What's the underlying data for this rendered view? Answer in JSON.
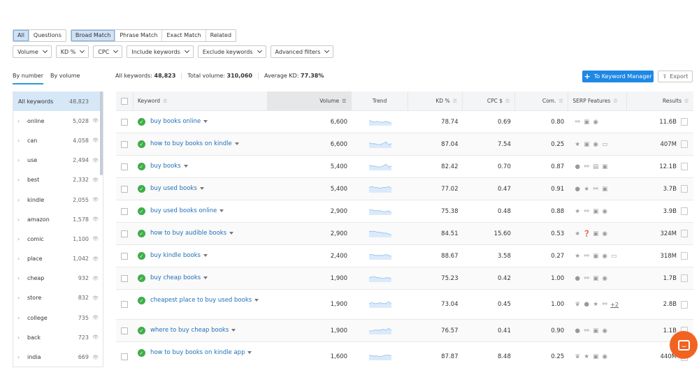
{
  "match_tabs": {
    "group1": [
      {
        "label": "All",
        "active": true
      },
      {
        "label": "Questions",
        "active": false
      }
    ],
    "group2": [
      {
        "label": "Broad Match",
        "active": true
      },
      {
        "label": "Phrase Match",
        "active": false
      },
      {
        "label": "Exact Match",
        "active": false
      },
      {
        "label": "Related",
        "active": false
      }
    ]
  },
  "filters": [
    "Volume",
    "KD %",
    "CPC",
    "Include keywords",
    "Exclude keywords",
    "Advanced filters"
  ],
  "side_tabs": [
    {
      "label": "By number",
      "active": true
    },
    {
      "label": "By volume",
      "active": false
    }
  ],
  "summary": {
    "all_keywords_label": "All keywords:",
    "all_keywords_value": "48,823",
    "total_volume_label": "Total volume:",
    "total_volume_value": "310,060",
    "avg_kd_label": "Average KD:",
    "avg_kd_value": "77.38%"
  },
  "actions": {
    "keyword_manager": "To Keyword Manager",
    "export": "Export"
  },
  "sidebar": {
    "all": {
      "label": "All keywords",
      "count": "48,823"
    },
    "items": [
      {
        "label": "online",
        "count": "5,028"
      },
      {
        "label": "can",
        "count": "4,058"
      },
      {
        "label": "use",
        "count": "2,494"
      },
      {
        "label": "best",
        "count": "2,332"
      },
      {
        "label": "kindle",
        "count": "2,055"
      },
      {
        "label": "amazon",
        "count": "1,578"
      },
      {
        "label": "comic",
        "count": "1,100"
      },
      {
        "label": "place",
        "count": "1,042"
      },
      {
        "label": "cheap",
        "count": "932"
      },
      {
        "label": "store",
        "count": "832"
      },
      {
        "label": "college",
        "count": "735"
      },
      {
        "label": "back",
        "count": "723"
      },
      {
        "label": "india",
        "count": "669"
      }
    ]
  },
  "table": {
    "headers": {
      "keyword": "Keyword",
      "volume": "Volume",
      "trend": "Trend",
      "kd": "KD %",
      "cpc": "CPC $",
      "com": "Com.",
      "serp": "SERP Features",
      "results": "Results"
    },
    "rows": [
      {
        "keyword": "buy books online",
        "volume": "6,600",
        "kd": "78.74",
        "cpc": "0.69",
        "com": "0.80",
        "serp": [
          "link",
          "review",
          "video"
        ],
        "serp_more": "",
        "results": "11.6B",
        "trend": [
          6,
          5,
          4,
          5,
          4,
          4,
          5,
          4,
          3
        ]
      },
      {
        "keyword": "how to buy books on kindle",
        "volume": "6,600",
        "kd": "87.04",
        "cpc": "7.54",
        "com": "0.25",
        "serp": [
          "star",
          "review",
          "video",
          "image"
        ],
        "serp_more": "",
        "results": "407M",
        "trend": [
          6,
          5,
          5,
          4,
          4,
          5,
          7,
          4,
          5
        ]
      },
      {
        "keyword": "buy books",
        "volume": "5,400",
        "kd": "82.42",
        "cpc": "0.70",
        "com": "0.87",
        "serp": [
          "pin",
          "link",
          "news",
          "review"
        ],
        "serp_more": "",
        "results": "12.1B",
        "trend": [
          6,
          5,
          5,
          4,
          4,
          5,
          7,
          4,
          5
        ]
      },
      {
        "keyword": "buy used books",
        "volume": "5,400",
        "kd": "77.02",
        "cpc": "0.47",
        "com": "0.91",
        "serp": [
          "pin",
          "star",
          "link",
          "review"
        ],
        "serp_more": "",
        "results": "3.7B",
        "trend": [
          6,
          7,
          6,
          6,
          5,
          6,
          6,
          7,
          5
        ]
      },
      {
        "keyword": "buy used books online",
        "volume": "2,900",
        "kd": "75.38",
        "cpc": "0.48",
        "com": "0.88",
        "serp": [
          "star",
          "link",
          "review",
          "video"
        ],
        "serp_more": "",
        "results": "3.9B",
        "trend": [
          6,
          6,
          5,
          5,
          5,
          4,
          4,
          5,
          3
        ]
      },
      {
        "keyword": "how to buy audible books",
        "volume": "2,900",
        "kd": "84.51",
        "cpc": "15.60",
        "com": "0.53",
        "serp": [
          "star",
          "question",
          "review",
          "video"
        ],
        "serp_more": "",
        "results": "324M",
        "trend": [
          7,
          7,
          7,
          6,
          6,
          5,
          5,
          4,
          3
        ]
      },
      {
        "keyword": "buy kindle books",
        "volume": "2,400",
        "kd": "88.67",
        "cpc": "3.58",
        "com": "0.27",
        "serp": [
          "star",
          "link",
          "review",
          "video",
          "image"
        ],
        "serp_more": "",
        "results": "318M",
        "trend": [
          6,
          6,
          5,
          5,
          5,
          5,
          6,
          5,
          4
        ]
      },
      {
        "keyword": "buy cheap books",
        "volume": "1,900",
        "kd": "75.23",
        "cpc": "0.42",
        "com": "1.00",
        "serp": [
          "pin",
          "link",
          "review",
          "video"
        ],
        "serp_more": "",
        "results": "1.7B",
        "trend": [
          5,
          6,
          6,
          5,
          5,
          4,
          5,
          5,
          4
        ]
      },
      {
        "keyword": "cheapest place to buy used books",
        "volume": "1,900",
        "kd": "73.04",
        "cpc": "0.45",
        "com": "1.00",
        "serp": [
          "crown",
          "pin",
          "star",
          "link"
        ],
        "serp_more": "+2",
        "results": "2.8B",
        "trend": [
          5,
          6,
          5,
          5,
          6,
          5,
          5,
          7,
          5
        ]
      },
      {
        "keyword": "where to buy cheap books",
        "volume": "1,900",
        "kd": "76.57",
        "cpc": "0.41",
        "com": "0.90",
        "serp": [
          "pin",
          "link",
          "review",
          "video"
        ],
        "serp_more": "",
        "results": "1.1B",
        "trend": [
          4,
          4,
          5,
          5,
          5,
          6,
          5,
          7,
          5
        ]
      },
      {
        "keyword": "how to buy books on kindle app",
        "volume": "1,600",
        "kd": "87.87",
        "cpc": "8.48",
        "com": "0.25",
        "serp": [
          "crown",
          "star",
          "review",
          "video"
        ],
        "serp_more": "",
        "results": "440M",
        "trend": [
          6,
          5,
          5,
          5,
          4,
          5,
          6,
          6,
          5
        ]
      }
    ]
  },
  "colors": {
    "accent": "#1e88e5",
    "link": "#1f6fb6",
    "ok": "#3fae49",
    "chat": "#f26322",
    "trend": "#9cc7ef"
  }
}
